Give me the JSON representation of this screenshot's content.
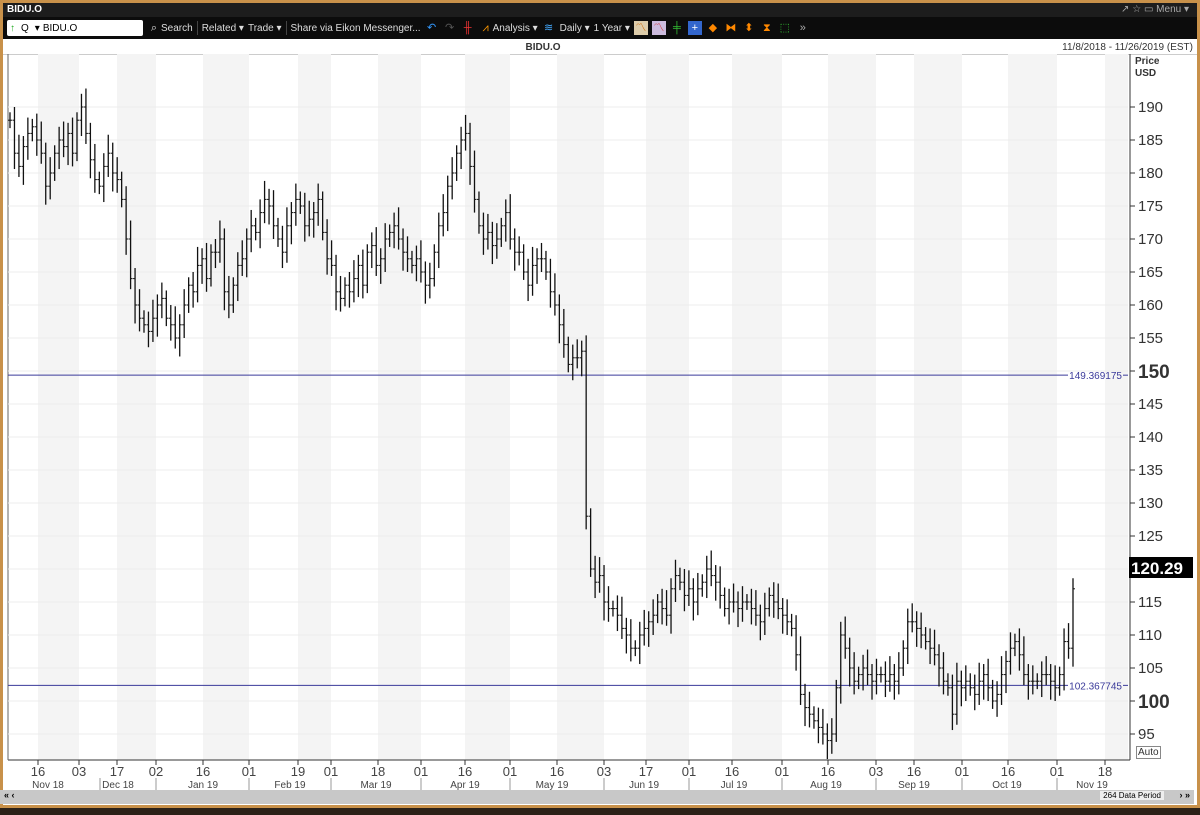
{
  "window": {
    "title": "BIDU.O",
    "controls": "↗ ☆ ▭ Menu ▾"
  },
  "toolbar": {
    "ric_value": "BIDU.O",
    "q_label": "Q",
    "search": "Search",
    "related": "Related ▾",
    "trade": "Trade ▾",
    "share": "Share via Eikon Messenger...",
    "analysis": "Analysis ▾",
    "interval": "Daily ▾",
    "range": "1 Year ▾"
  },
  "chart_header": {
    "title": "BIDU.O",
    "date_range": "11/8/2018 - 11/26/2019 (EST)"
  },
  "axis": {
    "title": "Price",
    "currency": "USD",
    "auto": "Auto",
    "last_price": "120.29"
  },
  "scrollbar": {
    "period": "264 Data Period",
    "left": "« ‹",
    "right": "› »"
  },
  "colors": {
    "line": "#3a3a9a",
    "bar": "#111111",
    "frame": "#c8914a"
  },
  "chart_data": {
    "type": "ohlc",
    "title": "BIDU.O",
    "ylabel": "Price USD",
    "ylim": [
      92,
      198
    ],
    "yticks": [
      95,
      100,
      105,
      110,
      115,
      120,
      125,
      130,
      135,
      140,
      145,
      150,
      155,
      160,
      165,
      170,
      175,
      180,
      185,
      190
    ],
    "bold_yticks": [
      100,
      150
    ],
    "hlines": [
      {
        "value": 149.369175,
        "label": "149.369175"
      },
      {
        "value": 102.367745,
        "label": "102.367745"
      }
    ],
    "xticks_day": [
      "16",
      "03",
      "17",
      "02",
      "16",
      "01",
      "19",
      "01",
      "18",
      "01",
      "16",
      "01",
      "16",
      "03",
      "17",
      "01",
      "16",
      "01",
      "16",
      "03",
      "16",
      "01",
      "16",
      "01",
      "18"
    ],
    "xticks_month": [
      "Nov 18",
      "Dec 18",
      "Jan 19",
      "Feb 19",
      "Mar 19",
      "Apr 19",
      "May 19",
      "Jun 19",
      "Jul 19",
      "Aug 19",
      "Sep 19",
      "Oct 19",
      "Nov 19"
    ],
    "close": [
      188,
      183,
      181,
      184,
      186,
      187,
      185,
      183,
      178,
      180,
      183,
      185,
      184,
      186,
      183,
      188,
      190,
      186,
      182,
      179,
      178,
      181,
      183,
      180,
      179,
      176,
      170,
      164,
      160,
      158,
      157,
      156,
      158,
      160,
      161,
      158,
      157,
      155,
      157,
      160,
      163,
      162,
      166,
      167,
      164,
      168,
      168,
      170,
      162,
      160,
      163,
      166,
      167,
      170,
      172,
      171,
      174,
      176,
      175,
      172,
      170,
      168,
      172,
      174,
      176,
      175,
      172,
      173,
      174,
      176,
      171,
      167,
      166,
      162,
      161,
      163,
      162,
      164,
      166,
      163,
      168,
      169,
      166,
      167,
      170,
      171,
      172,
      170,
      168,
      167,
      166,
      167,
      165,
      163,
      164,
      168,
      172,
      174,
      178,
      180,
      183,
      185,
      186,
      181,
      176,
      172,
      170,
      171,
      169,
      170,
      172,
      174,
      170,
      168,
      168,
      165,
      163,
      166,
      167,
      167,
      165,
      162,
      160,
      157,
      154,
      151,
      152,
      152,
      153,
      128,
      120,
      118,
      119,
      115,
      114,
      114,
      113,
      111,
      110,
      108,
      108,
      110,
      111,
      112,
      113,
      115,
      114,
      113,
      117,
      119,
      118,
      116,
      117,
      115,
      117,
      118,
      120,
      119,
      118,
      116,
      114,
      115,
      115,
      114,
      115,
      115,
      114,
      113,
      112,
      114,
      116,
      115,
      114,
      113,
      112,
      111,
      107,
      101,
      99,
      98,
      97,
      96,
      95,
      94,
      95,
      102,
      110,
      108,
      105,
      103,
      104,
      105,
      104,
      103,
      104,
      104,
      103,
      104,
      103,
      105,
      108,
      112,
      112,
      111,
      110,
      109,
      108,
      107,
      105,
      103,
      102,
      98,
      103,
      102,
      103,
      102,
      101,
      103,
      104,
      102,
      100,
      101,
      104,
      106,
      108,
      109,
      107,
      104,
      103,
      103,
      103,
      104,
      104,
      103,
      102,
      104,
      109,
      108,
      117
    ]
  }
}
